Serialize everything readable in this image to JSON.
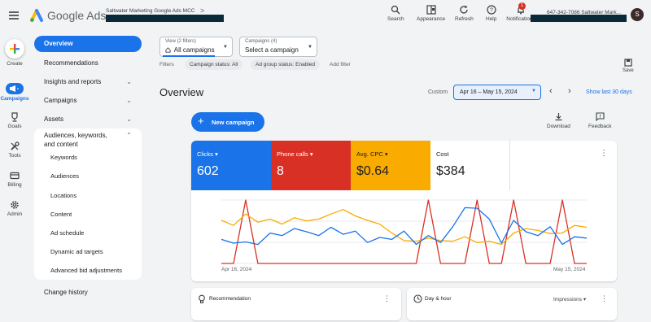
{
  "header": {
    "brand": "Google Ads",
    "account_name": "Saltwater Marketing Google Ads MCC",
    "account_chevron": ">",
    "buttons": [
      {
        "label": "Search",
        "icon": "search-icon"
      },
      {
        "label": "Appearance",
        "icon": "appearance-icon"
      },
      {
        "label": "Refresh",
        "icon": "refresh-icon"
      },
      {
        "label": "Help",
        "icon": "help-icon"
      },
      {
        "label": "Notifications",
        "icon": "bell-icon",
        "badge": "1"
      }
    ],
    "account_right": "647-342-7086 Saltwater Mark...",
    "avatar_initial": "S"
  },
  "rail": {
    "items": [
      {
        "label": "Create",
        "icon": "plus-icon"
      },
      {
        "label": "Campaigns",
        "icon": "megaphone-icon"
      },
      {
        "label": "Goals",
        "icon": "trophy-icon"
      },
      {
        "label": "Tools",
        "icon": "wrench-icon"
      },
      {
        "label": "Billing",
        "icon": "credit-card-icon"
      },
      {
        "label": "Admin",
        "icon": "gear-icon"
      }
    ]
  },
  "nav": {
    "items": [
      {
        "label": "Overview"
      },
      {
        "label": "Recommendations"
      },
      {
        "label": "Insights and reports",
        "chevron": "⌄"
      },
      {
        "label": "Campaigns",
        "chevron": "⌄"
      },
      {
        "label": "Assets",
        "chevron": "⌄"
      },
      {
        "label": "Audiences, keywords, and content",
        "chevron": "⌃"
      }
    ],
    "sub_items": [
      "Keywords",
      "Audiences",
      "Locations",
      "Content",
      "Ad schedule",
      "Dynamic ad targets",
      "Advanced bid adjustments"
    ],
    "change_history": "Change history"
  },
  "filters": {
    "view_label": "View (2 filters)",
    "view_value": "All campaigns",
    "campaigns_label": "Campaigns (4)",
    "campaigns_value": "Select a campaign",
    "filters_label": "Filters",
    "chips": [
      "Campaign status: All",
      "Ad group status: Enabled"
    ],
    "add_filter": "Add filter",
    "save_label": "Save"
  },
  "main": {
    "title": "Overview",
    "date_custom_label": "Custom",
    "date_range": "Apr 16 – May 15, 2024",
    "show_last": "Show last 30 days",
    "new_campaign": "New campaign",
    "download_label": "Download",
    "feedback_label": "Feedback"
  },
  "metrics": [
    {
      "label": "Clicks",
      "value": "602",
      "color": "#1a73e8",
      "dropdown": true
    },
    {
      "label": "Phone calls",
      "value": "8",
      "color": "#d93025",
      "dropdown": true
    },
    {
      "label": "Avg. CPC",
      "value": "$0.64",
      "color": "#f9ab00",
      "dropdown": true
    },
    {
      "label": "Cost",
      "value": "$384",
      "color": "#ffffff",
      "dropdown": false
    }
  ],
  "chart_data": {
    "type": "line",
    "x_start_label": "Apr 16, 2024",
    "x_end_label": "May 15, 2024",
    "grid": true,
    "series": [
      {
        "color": "#1a73e8",
        "values": [
          0.38,
          0.32,
          0.34,
          0.3,
          0.48,
          0.44,
          0.55,
          0.5,
          0.44,
          0.57,
          0.46,
          0.51,
          0.33,
          0.41,
          0.38,
          0.51,
          0.3,
          0.44,
          0.33,
          0.58,
          0.88,
          0.87,
          0.7,
          0.32,
          0.68,
          0.5,
          0.44,
          0.58,
          0.3,
          0.42,
          0.4
        ]
      },
      {
        "color": "#f9ab00",
        "values": [
          0.68,
          0.6,
          0.78,
          0.65,
          0.7,
          0.62,
          0.72,
          0.67,
          0.7,
          0.78,
          0.85,
          0.75,
          0.68,
          0.62,
          0.48,
          0.36,
          0.35,
          0.4,
          0.36,
          0.35,
          0.42,
          0.33,
          0.35,
          0.3,
          0.48,
          0.55,
          0.52,
          0.47,
          0.48,
          0.6,
          0.57
        ]
      },
      {
        "color": "#d93025",
        "values": [
          0.0,
          0.0,
          1.0,
          0.0,
          0.0,
          0.0,
          0.0,
          0.0,
          0.0,
          0.0,
          0.0,
          0.0,
          0.0,
          0.0,
          0.0,
          0.0,
          0.0,
          1.0,
          0.0,
          0.0,
          0.0,
          1.0,
          0.0,
          0.0,
          1.0,
          0.0,
          0.0,
          0.0,
          1.0,
          0.0,
          0.0
        ]
      }
    ]
  },
  "bottom_cards": [
    {
      "title": "Recommendation",
      "icon": "lightbulb-icon"
    },
    {
      "title": "Day & hour",
      "icon": "clock-icon",
      "select": "Impressions"
    }
  ]
}
